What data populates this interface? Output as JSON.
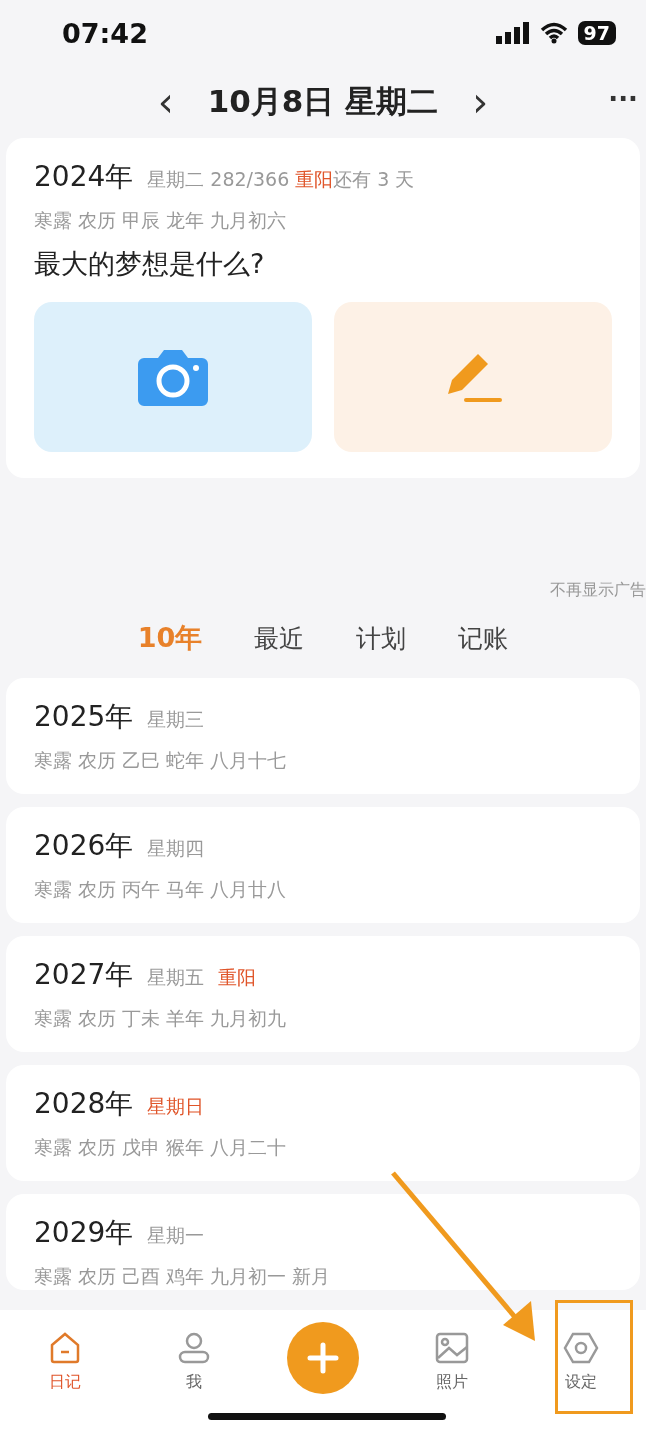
{
  "status_bar": {
    "time": "07:42",
    "battery": "97"
  },
  "header": {
    "title": "10月8日 星期二",
    "prev": "‹",
    "next": "›",
    "more": "···"
  },
  "today": {
    "year": "2024年",
    "meta": [
      {
        "text": "星期二 282/366 ",
        "highlight": false
      },
      {
        "text": "重阳",
        "highlight": true
      },
      {
        "text": "还有 3 天",
        "highlight": false
      }
    ],
    "lunar": "寒露 农历 甲辰 龙年 九月初六",
    "question": "最大的梦想是什么?"
  },
  "ad_note": "不再显示广告",
  "tabs": [
    {
      "label": "10年",
      "selected": true
    },
    {
      "label": "最近",
      "selected": false
    },
    {
      "label": "计划",
      "selected": false
    },
    {
      "label": "记账",
      "selected": false
    }
  ],
  "years": [
    {
      "year": "2025年",
      "meta": [
        {
          "text": "星期三",
          "highlight": false
        }
      ],
      "lunar": "寒露 农历 乙巳 蛇年 八月十七"
    },
    {
      "year": "2026年",
      "meta": [
        {
          "text": "星期四",
          "highlight": false
        }
      ],
      "lunar": "寒露 农历 丙午 马年 八月廿八"
    },
    {
      "year": "2027年",
      "meta": [
        {
          "text": "星期五",
          "highlight": false
        },
        {
          "text": "重阳",
          "highlight": true
        }
      ],
      "lunar": "寒露 农历 丁未 羊年 九月初九"
    },
    {
      "year": "2028年",
      "meta": [
        {
          "text": "星期日",
          "highlight": true
        }
      ],
      "lunar": "寒露 农历 戊申 猴年 八月二十"
    },
    {
      "year": "2029年",
      "meta": [
        {
          "text": "星期一",
          "highlight": false
        }
      ],
      "lunar": "寒露 农历 己酉 鸡年 九月初一 新月"
    }
  ],
  "tab_bar": [
    {
      "kind": "tab",
      "label": "日记",
      "selected": true
    },
    {
      "kind": "tab",
      "label": "我",
      "selected": false
    },
    {
      "kind": "add",
      "selected": false
    },
    {
      "kind": "tab",
      "label": "照片",
      "selected": false
    },
    {
      "kind": "tab",
      "label": "设定",
      "selected": false
    }
  ]
}
